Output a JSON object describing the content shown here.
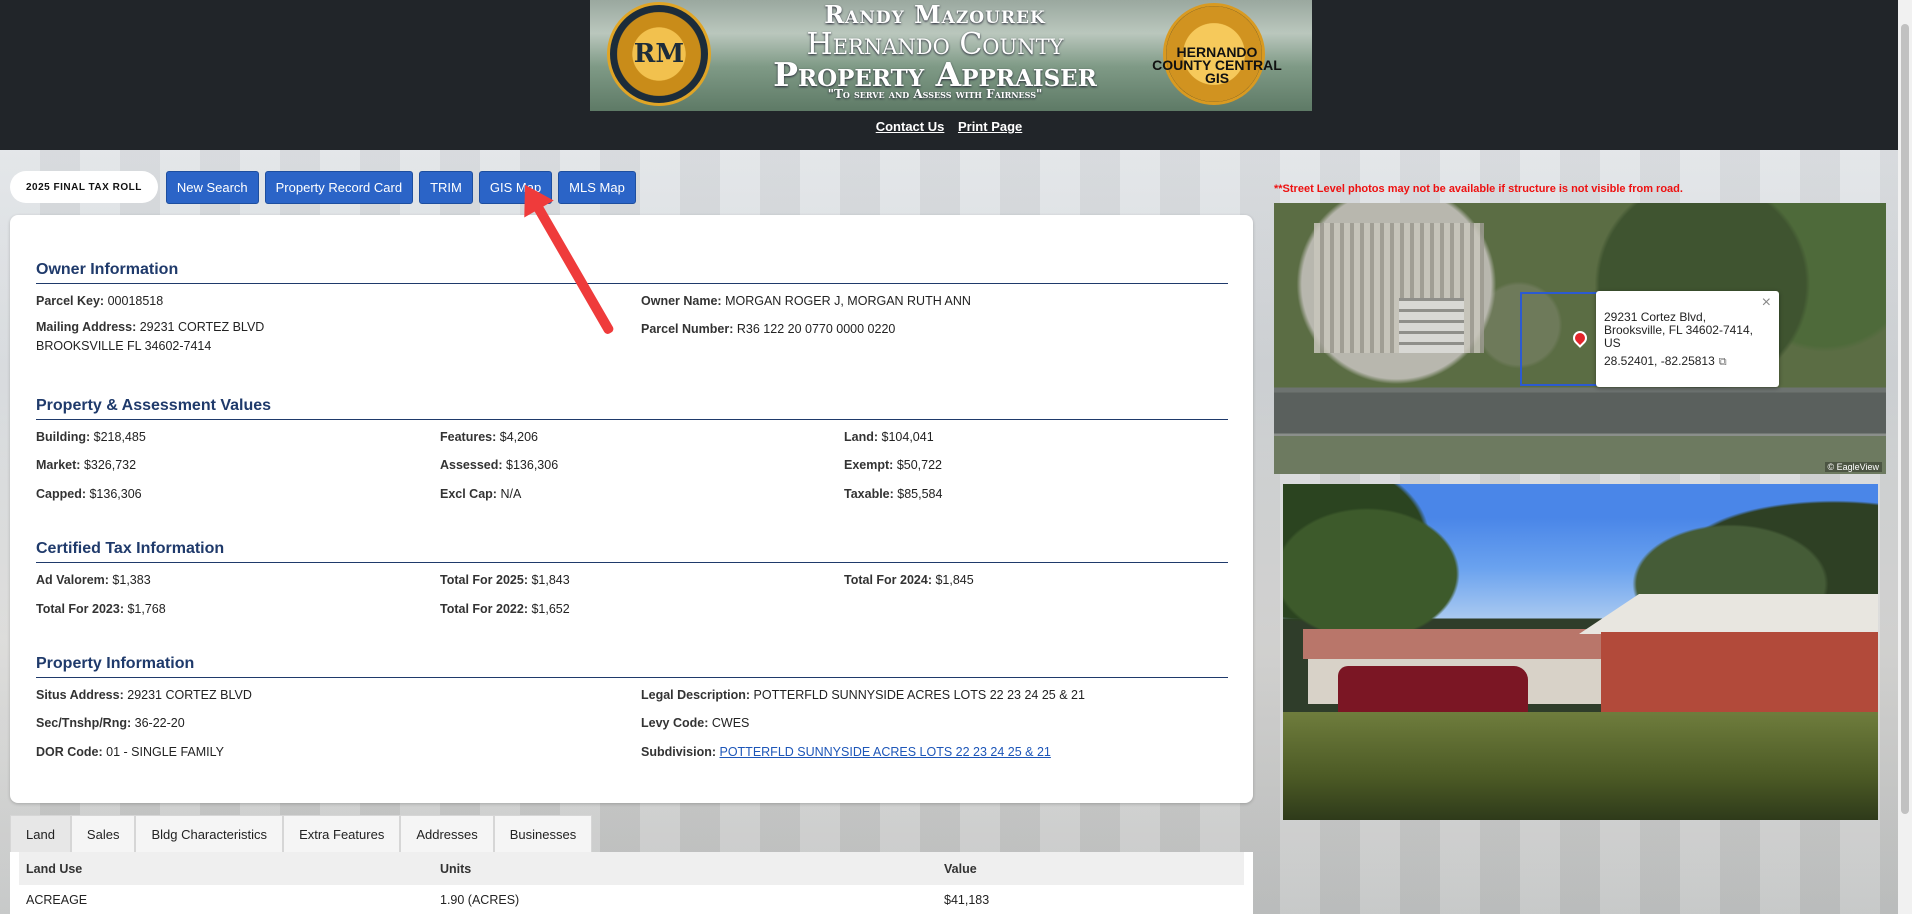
{
  "banner": {
    "name": "Randy Mazourek",
    "county": "Hernando County",
    "office": "Property Appraiser",
    "motto": "\"To serve and Assess with Fairness\"",
    "seal_left_text": "RM",
    "seal_right_text": "HERNANDO COUNTY CENTRAL GIS"
  },
  "header_links": {
    "contact": "Contact Us",
    "print": "Print Page"
  },
  "toolbar": {
    "tax_roll": "2025 FINAL TAX ROLL",
    "buttons": [
      "New Search",
      "Property Record Card",
      "TRIM",
      "GIS Map",
      "MLS Map"
    ]
  },
  "owner": {
    "title": "Owner Information",
    "parcel_key_label": "Parcel Key:",
    "parcel_key": "00018518",
    "owner_name_label": "Owner Name:",
    "owner_name": "MORGAN ROGER J, MORGAN RUTH ANN",
    "mailing_label": "Mailing Address:",
    "mailing_line1": "29231 CORTEZ BLVD",
    "mailing_line2": "BROOKSVILLE FL 34602-7414",
    "parcel_number_label": "Parcel Number:",
    "parcel_number": "R36 122 20 0770 0000 0220"
  },
  "values": {
    "title": "Property & Assessment Values",
    "items": [
      {
        "label": "Building:",
        "value": "$218,485"
      },
      {
        "label": "Features:",
        "value": "$4,206"
      },
      {
        "label": "Land:",
        "value": "$104,041"
      },
      {
        "label": "Market:",
        "value": "$326,732"
      },
      {
        "label": "Assessed:",
        "value": "$136,306"
      },
      {
        "label": "Exempt:",
        "value": "$50,722"
      },
      {
        "label": "Capped:",
        "value": "$136,306"
      },
      {
        "label": "Excl Cap:",
        "value": "N/A"
      },
      {
        "label": "Taxable:",
        "value": "$85,584"
      }
    ]
  },
  "tax": {
    "title": "Certified Tax Information",
    "items": [
      {
        "label": "Ad Valorem:",
        "value": "$1,383"
      },
      {
        "label": "Total For 2025:",
        "value": "$1,843"
      },
      {
        "label": "Total For 2024:",
        "value": "$1,845"
      },
      {
        "label": "Total For 2023:",
        "value": "$1,768"
      },
      {
        "label": "Total For 2022:",
        "value": "$1,652"
      }
    ]
  },
  "property": {
    "title": "Property Information",
    "situs_label": "Situs Address:",
    "situs": "29231 CORTEZ BLVD",
    "legal_label": "Legal Description:",
    "legal": "POTTERFLD SUNNYSIDE ACRES LOTS 22 23 24 25 & 21",
    "sec_label": "Sec/Tnshp/Rng:",
    "sec": "36-22-20",
    "levy_label": "Levy Code:",
    "levy": "CWES",
    "dor_label": "DOR Code:",
    "dor": "01 - SINGLE FAMILY",
    "subdivision_label": "Subdivision:",
    "subdivision": "POTTERFLD SUNNYSIDE ACRES LOTS 22 23 24 25 & 21"
  },
  "street_note": "**Street Level photos may not be available if structure is not visible from road.",
  "map_popup": {
    "line1": "29231 Cortez Blvd,",
    "line2": "Brooksville, FL 34602-7414,",
    "line3": "US",
    "coords": "28.52401, -82.25813",
    "close": "×",
    "copy_icon": "⧉",
    "credit": "© EagleView"
  },
  "tabs": [
    "Land",
    "Sales",
    "Bldg Characteristics",
    "Extra Features",
    "Addresses",
    "Businesses"
  ],
  "land_table": {
    "headers": [
      "Land Use",
      "Units",
      "Value"
    ],
    "rows": [
      [
        "ACREAGE",
        "1.90 (ACRES)",
        "$41,183"
      ]
    ]
  }
}
